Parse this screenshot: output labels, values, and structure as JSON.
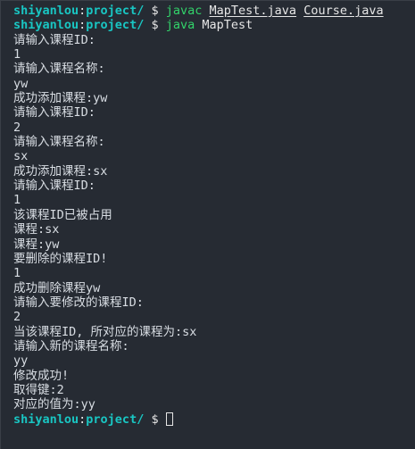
{
  "prompt": {
    "user": "shiyanlou",
    "separator": ":",
    "path": "project/",
    "symbol": "$"
  },
  "commands": [
    {
      "cmd": "javac",
      "args": [
        "MapTest.java",
        "Course.java"
      ]
    },
    {
      "cmd": "java",
      "args_plain": "MapTest"
    }
  ],
  "output_lines": [
    "请输入课程ID:",
    "1",
    "请输入课程名称:",
    "yw",
    "成功添加课程:yw",
    "请输入课程ID:",
    "2",
    "请输入课程名称:",
    "sx",
    "成功添加课程:sx",
    "请输入课程ID:",
    "1",
    "该课程ID已被占用",
    "课程:sx",
    "课程:yw",
    "要删除的课程ID!",
    "1",
    "成功删除课程yw",
    "请输入要修改的课程ID:",
    "2",
    "当该课程ID, 所对应的课程为:sx",
    "请输入新的课程名称:",
    "yy",
    "修改成功!",
    "取得键:2",
    "对应的值为:yy"
  ],
  "colors": {
    "background": "#262b33",
    "prompt": "#19c6c3",
    "command": "#32d26a",
    "text": "#d8dde3"
  }
}
